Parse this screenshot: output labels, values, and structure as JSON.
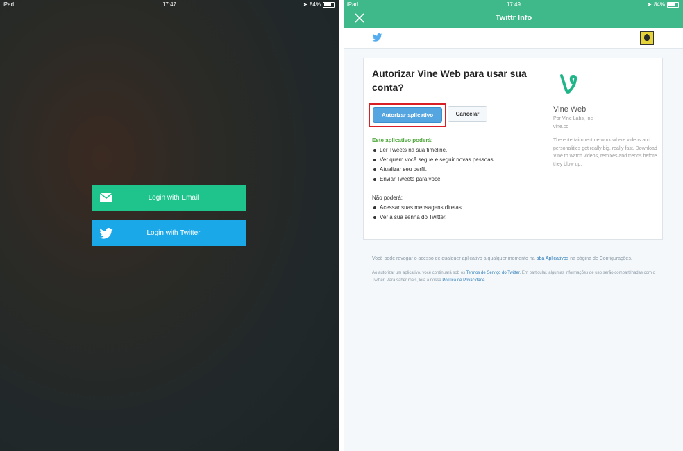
{
  "left": {
    "status": {
      "carrier": "iPad",
      "time": "17:47",
      "battery": "84%"
    },
    "login_email": {
      "label": "Login with Email",
      "icon": "envelope-icon"
    },
    "login_twitter": {
      "label": "Login with Twitter",
      "icon": "twitter-bird-icon"
    },
    "colors": {
      "email": "#1ec48b",
      "twitter": "#1aa8e9"
    }
  },
  "right": {
    "status": {
      "carrier": "iPad",
      "time": "17:49",
      "battery": "84%"
    },
    "title": "Twittr Info",
    "card": {
      "heading": "Autorizar Vine Web para usar sua conta?",
      "authorize_label": "Autorizar aplicativo",
      "cancel_label": "Cancelar",
      "can_heading": "Este aplicativo poderá:",
      "can_items": [
        "Ler Tweets na sua timeline.",
        "Ver quem você segue e seguir novas pessoas.",
        "Atualizar seu perfil.",
        "Enviar Tweets para você."
      ],
      "cannot_heading": "Não poderá:",
      "cannot_items": [
        "Acessar suas mensagens diretas.",
        "Ver a sua senha do Twitter."
      ],
      "app": {
        "name": "Vine Web",
        "by": "Por Vine Labs, Inc",
        "url": "vine.co",
        "description": "The entertainment network where videos and personalities get really big, really fast. Download Vine to watch videos, remixes and trends before they blow up."
      }
    },
    "footer": {
      "p1_pre": "Você pode revogar o acesso de qualquer aplicativo a qualquer momento na ",
      "p1_link": "aba Aplicativos",
      "p1_post": " na página de Configurações.",
      "p2_pre": "Ao autorizar um aplicativo, você continuará sob os ",
      "p2_link1": "Termos de Serviço do Twitter",
      "p2_mid": ". Em particular, algumas informações de uso serão compartilhadas com o Twitter. Para saber mais, leia a nossa ",
      "p2_link2": "Política de Privacidade",
      "p2_post": "."
    },
    "colors": {
      "topbar": "#3fb88a",
      "authorize": "#55a6e0",
      "highlight": "#d81f26",
      "can_heading": "#4fa73c"
    }
  }
}
